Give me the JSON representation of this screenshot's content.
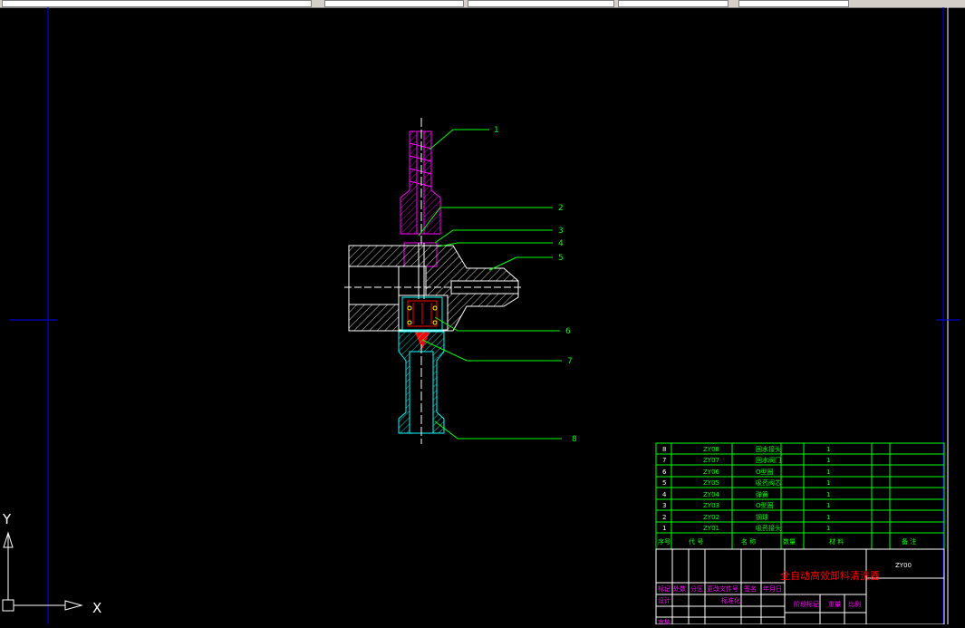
{
  "callouts": [
    "1",
    "2",
    "3",
    "4",
    "5",
    "6",
    "7",
    "8"
  ],
  "bom": [
    {
      "no": "8",
      "code": "ZY08",
      "name": "回水接头",
      "qty": "1"
    },
    {
      "no": "7",
      "code": "ZY07",
      "name": "回水阀门",
      "qty": "1"
    },
    {
      "no": "6",
      "code": "ZY06",
      "name": "O型圈",
      "qty": "1"
    },
    {
      "no": "5",
      "code": "ZY05",
      "name": "吸药阀芯",
      "qty": "1"
    },
    {
      "no": "4",
      "code": "ZY04",
      "name": "弹簧",
      "qty": "1"
    },
    {
      "no": "3",
      "code": "ZY03",
      "name": "O型圈",
      "qty": "1"
    },
    {
      "no": "2",
      "code": "ZY02",
      "name": "钢球",
      "qty": "1"
    },
    {
      "no": "1",
      "code": "ZY01",
      "name": "吸药接头",
      "qty": "1"
    }
  ],
  "bom_header": {
    "no": "序号",
    "code": "代 号",
    "name": "名 称",
    "qty": "数量",
    "material": "材 料",
    "remark": "备 注"
  },
  "title_block": {
    "title": "全自动高效卸料清洗器",
    "drawing_no": "ZY00",
    "row1": [
      "标记",
      "处数",
      "分区",
      "更改文件号",
      "签名",
      "年月日"
    ],
    "row2": [
      "设计",
      "",
      "",
      "标准化"
    ],
    "row3": [
      "阶段标记",
      "重量",
      "比例"
    ],
    "row4": [
      "审核"
    ]
  },
  "ucs": {
    "x": "X",
    "y": "Y"
  },
  "colors": {
    "green": "#00ff00",
    "magenta": "#ff00ff",
    "cyan": "#00ffff",
    "red": "#ff0000",
    "blue": "#0000ff",
    "white": "#ffffff"
  }
}
